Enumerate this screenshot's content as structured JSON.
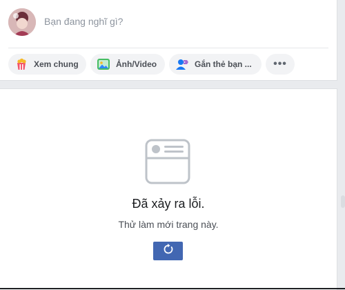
{
  "composer": {
    "prompt": "Bạn đang nghĩ gì?",
    "actions": [
      {
        "label": "Xem chung",
        "icon": "watch-party-icon"
      },
      {
        "label": "Ảnh/Video",
        "icon": "photo-video-icon"
      },
      {
        "label": "Gắn thẻ bạn ...",
        "icon": "tag-friends-icon"
      }
    ],
    "more_label": "•••"
  },
  "error": {
    "title": "Đã xảy ra lỗi.",
    "subtitle": "Thử làm mới trang này.",
    "icon": "broken-feed-icon",
    "button_icon": "refresh-icon"
  },
  "colors": {
    "accent": "#4267b2",
    "pill_bg": "#f2f3f5",
    "page_bg": "#e9ebee"
  }
}
